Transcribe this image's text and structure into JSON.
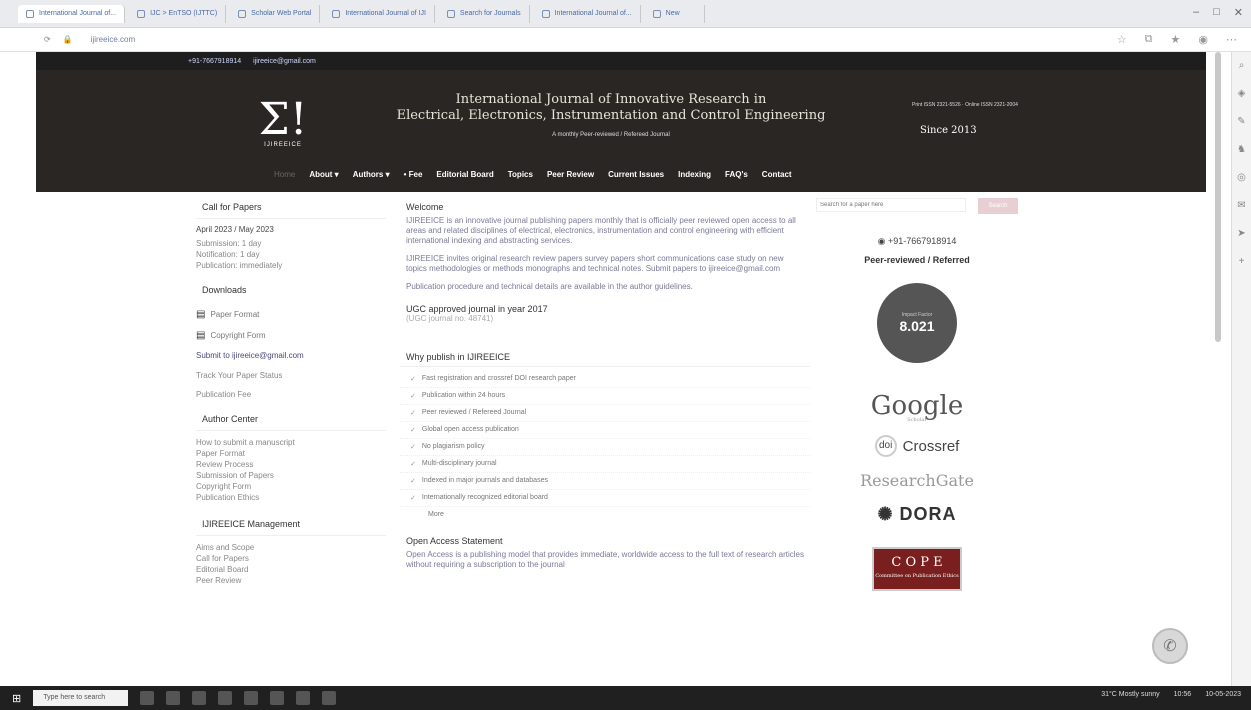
{
  "browser": {
    "tabs": [
      {
        "label": "International Journal of..."
      },
      {
        "label": "IJC > EnTSO (IJTTC)"
      },
      {
        "label": "Scholar Web Portal"
      },
      {
        "label": "International Journal of IJI"
      },
      {
        "label": "Search for Journals"
      },
      {
        "label": "International Journal of..."
      },
      {
        "label": "New"
      }
    ],
    "url": "ijireeice.com"
  },
  "topstrip": {
    "phone": "+91-7667918914",
    "email": "ijireeice@gmail.com"
  },
  "header": {
    "logo": "Σ!",
    "logo_sub": "IJIREEICE",
    "title_line1": "International Journal of Innovative Research in",
    "title_line2": "Electrical, Electronics, Instrumentation and Control Engineering",
    "title_line3": "A monthly Peer-reviewed / Refereed Journal",
    "issn": "Print ISSN 2321-5526 · Online ISSN 2321-2004",
    "since": "Since 2013"
  },
  "nav": [
    "Home",
    "About ▾",
    "Authors ▾",
    "• Fee",
    "Editorial Board",
    "Topics",
    "Peer Review",
    "Current Issues",
    "Indexing",
    "FAQ's",
    "Contact"
  ],
  "left": {
    "call_title": "Call for Papers",
    "call_date": "April 2023 / May 2023",
    "call_lines": [
      "Submission: 1 day",
      "Notification: 1 day",
      "Publication: immediately"
    ],
    "downloads_title": "Downloads",
    "downloads": [
      "Paper Format",
      "Copyright Form"
    ],
    "submit": "Submit to ijireeice@gmail.com",
    "links": [
      "Track Your Paper Status",
      "Publication Fee"
    ],
    "author_title": "Author Center",
    "author_links": [
      "How to submit a manuscript",
      "Paper Format",
      "Review Process",
      "Submission of Papers",
      "Copyright Form",
      "Publication Ethics"
    ],
    "mgmt_title": "IJIREEICE Management",
    "mgmt_links": [
      "Aims and Scope",
      "Call for Papers",
      "Editorial Board",
      "Peer Review"
    ]
  },
  "middle": {
    "welcome_title": "Welcome",
    "welcome_para": "IJIREEICE is an innovative journal publishing papers monthly that is officially peer reviewed open access to all areas and related disciplines of electrical, electronics, instrumentation and control engineering with efficient international indexing and abstracting services.",
    "para2": "IJIREEICE invites original research review papers survey papers short communications case study on new topics methodologies or methods monographs and technical notes. Submit papers to ijireeice@gmail.com",
    "para3": "Publication procedure and technical details are available in the author guidelines.",
    "ugc": "UGC approved journal in year 2017",
    "ugc_sub": "(UGC journal no. 48741)",
    "why_title": "Why publish in IJIREEICE",
    "why": [
      "Fast registration and crossref DOI research paper",
      "Publication within 24 hours",
      "Peer reviewed / Refereed Journal",
      "Global open access publication",
      "No plagiarism policy",
      "Multi-disciplinary journal",
      "Indexed in major journals and databases",
      "Internationally recognized editorial board",
      "More"
    ],
    "oa_title": "Open Access Statement",
    "oa_para": "Open Access is a publishing model that provides immediate, worldwide access to the full text of research articles without requiring a subscription to the journal"
  },
  "right": {
    "search_placeholder": "Search for a paper here",
    "search_btn": "Search",
    "phone": "+91-7667918914",
    "peer": "Peer-reviewed / Referred",
    "impact_caption": "Impact Factor",
    "impact_value": "8.021",
    "google": "Google",
    "google_sub": "Scholar",
    "doi": "doi",
    "crossref": "Crossref",
    "researchgate": "ResearchGate",
    "dora": "DORA",
    "cope": "C O P E",
    "cope_sub": "Committee on Publication Ethics"
  },
  "taskbar": {
    "search": "Type here to search",
    "weather": "31°C Mostly sunny",
    "time": "10:56",
    "date": "10-05-2023"
  }
}
